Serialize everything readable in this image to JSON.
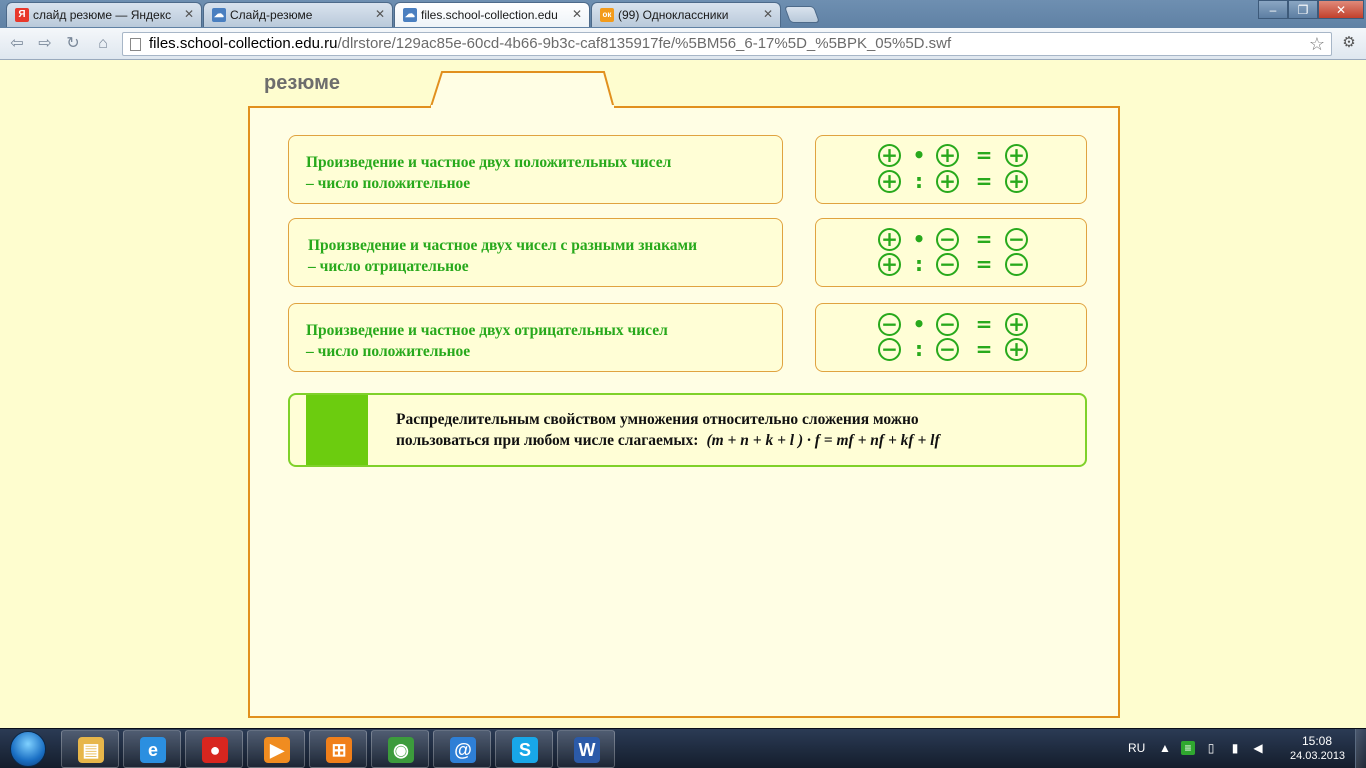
{
  "browser": {
    "tabs": [
      {
        "title": "слайд резюме — Яндекс",
        "favicon": "Я",
        "favicon_color": "#e8382b",
        "active": false
      },
      {
        "title": "Слайд-резюме",
        "favicon": "☁",
        "favicon_color": "#4a7fc0",
        "active": false
      },
      {
        "title": "files.school-collection.edu",
        "favicon": "☁",
        "favicon_color": "#4a7fc0",
        "active": true
      },
      {
        "title": "(99) Одноклассники",
        "favicon": "ок",
        "favicon_color": "#f39b1b",
        "active": false
      }
    ],
    "address": {
      "host": "files.school-collection.edu.ru",
      "path": "/dlrstore/129ac85e-60cd-4b66-9b3c-caf8135917fe/%5BM56_6-17%5D_%5BPK_05%5D.swf"
    },
    "window_buttons": {
      "minimize": "–",
      "restore": "❐",
      "close": "✕"
    }
  },
  "slide": {
    "title": "резюме",
    "accent_color": "#28a91c",
    "border_color": "#e1901e",
    "rules": [
      {
        "line1": "Произведение и частное двух положительных чисел",
        "line2": "– число положительное",
        "row1": {
          "a": "+",
          "op": "•",
          "b": "+",
          "eq": "=",
          "r": "+"
        },
        "row2": {
          "a": "+",
          "op": ":",
          "b": "+",
          "eq": "=",
          "r": "+"
        }
      },
      {
        "line1": "Произведение и частное двух чисел с разными знаками",
        "line2": "– число отрицательное",
        "row1": {
          "a": "+",
          "op": "•",
          "b": "−",
          "eq": "=",
          "r": "−"
        },
        "row2": {
          "a": "+",
          "op": ":",
          "b": "−",
          "eq": "=",
          "r": "−"
        }
      },
      {
        "line1": "Произведение и частное двух отрицательных чисел",
        "line2": "– число положительное",
        "row1": {
          "a": "−",
          "op": "•",
          "b": "−",
          "eq": "=",
          "r": "+"
        },
        "row2": {
          "a": "−",
          "op": ":",
          "b": "−",
          "eq": "=",
          "r": "+"
        }
      }
    ],
    "distributive": {
      "line1": "Распределительным свойством умножения относительно сложения можно",
      "line2": "пользоваться при любом числе слагаемых:",
      "formula": "(m + n + k + l ) · f = mf + nf + kf + lf"
    }
  },
  "taskbar": {
    "apps": [
      {
        "name": "explorer",
        "glyph": "▤",
        "color": "#e7b64a"
      },
      {
        "name": "internet-explorer",
        "glyph": "e",
        "color": "#2b8fe0"
      },
      {
        "name": "app-red-ball",
        "glyph": "●",
        "color": "#d8261f"
      },
      {
        "name": "media-player",
        "glyph": "▶",
        "color": "#f08c20"
      },
      {
        "name": "app-orange",
        "glyph": "⊞",
        "color": "#f07f1a"
      },
      {
        "name": "chrome",
        "glyph": "◉",
        "color": "#3c9b3c"
      },
      {
        "name": "mail-agent",
        "glyph": "@",
        "color": "#2e7fd6"
      },
      {
        "name": "skype",
        "glyph": "S",
        "color": "#18a7e8"
      },
      {
        "name": "word",
        "glyph": "W",
        "color": "#2b5aa8"
      }
    ],
    "language": "RU",
    "time": "15:08",
    "date": "24.03.2013"
  }
}
